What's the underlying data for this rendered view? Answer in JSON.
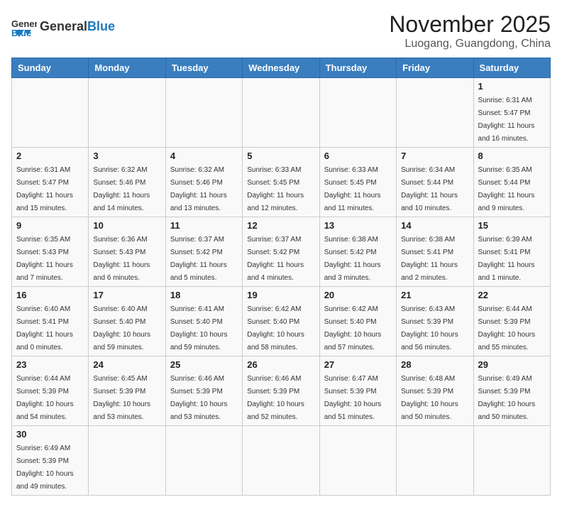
{
  "header": {
    "logo_general": "General",
    "logo_blue": "Blue",
    "month_title": "November 2025",
    "location": "Luogang, Guangdong, China"
  },
  "weekdays": [
    "Sunday",
    "Monday",
    "Tuesday",
    "Wednesday",
    "Thursday",
    "Friday",
    "Saturday"
  ],
  "days": {
    "d1": {
      "num": "1",
      "info": "Sunrise: 6:31 AM\nSunset: 5:47 PM\nDaylight: 11 hours\nand 16 minutes."
    },
    "d2": {
      "num": "2",
      "info": "Sunrise: 6:31 AM\nSunset: 5:47 PM\nDaylight: 11 hours\nand 15 minutes."
    },
    "d3": {
      "num": "3",
      "info": "Sunrise: 6:32 AM\nSunset: 5:46 PM\nDaylight: 11 hours\nand 14 minutes."
    },
    "d4": {
      "num": "4",
      "info": "Sunrise: 6:32 AM\nSunset: 5:46 PM\nDaylight: 11 hours\nand 13 minutes."
    },
    "d5": {
      "num": "5",
      "info": "Sunrise: 6:33 AM\nSunset: 5:45 PM\nDaylight: 11 hours\nand 12 minutes."
    },
    "d6": {
      "num": "6",
      "info": "Sunrise: 6:33 AM\nSunset: 5:45 PM\nDaylight: 11 hours\nand 11 minutes."
    },
    "d7": {
      "num": "7",
      "info": "Sunrise: 6:34 AM\nSunset: 5:44 PM\nDaylight: 11 hours\nand 10 minutes."
    },
    "d8": {
      "num": "8",
      "info": "Sunrise: 6:35 AM\nSunset: 5:44 PM\nDaylight: 11 hours\nand 9 minutes."
    },
    "d9": {
      "num": "9",
      "info": "Sunrise: 6:35 AM\nSunset: 5:43 PM\nDaylight: 11 hours\nand 7 minutes."
    },
    "d10": {
      "num": "10",
      "info": "Sunrise: 6:36 AM\nSunset: 5:43 PM\nDaylight: 11 hours\nand 6 minutes."
    },
    "d11": {
      "num": "11",
      "info": "Sunrise: 6:37 AM\nSunset: 5:42 PM\nDaylight: 11 hours\nand 5 minutes."
    },
    "d12": {
      "num": "12",
      "info": "Sunrise: 6:37 AM\nSunset: 5:42 PM\nDaylight: 11 hours\nand 4 minutes."
    },
    "d13": {
      "num": "13",
      "info": "Sunrise: 6:38 AM\nSunset: 5:42 PM\nDaylight: 11 hours\nand 3 minutes."
    },
    "d14": {
      "num": "14",
      "info": "Sunrise: 6:38 AM\nSunset: 5:41 PM\nDaylight: 11 hours\nand 2 minutes."
    },
    "d15": {
      "num": "15",
      "info": "Sunrise: 6:39 AM\nSunset: 5:41 PM\nDaylight: 11 hours\nand 1 minute."
    },
    "d16": {
      "num": "16",
      "info": "Sunrise: 6:40 AM\nSunset: 5:41 PM\nDaylight: 11 hours\nand 0 minutes."
    },
    "d17": {
      "num": "17",
      "info": "Sunrise: 6:40 AM\nSunset: 5:40 PM\nDaylight: 10 hours\nand 59 minutes."
    },
    "d18": {
      "num": "18",
      "info": "Sunrise: 6:41 AM\nSunset: 5:40 PM\nDaylight: 10 hours\nand 59 minutes."
    },
    "d19": {
      "num": "19",
      "info": "Sunrise: 6:42 AM\nSunset: 5:40 PM\nDaylight: 10 hours\nand 58 minutes."
    },
    "d20": {
      "num": "20",
      "info": "Sunrise: 6:42 AM\nSunset: 5:40 PM\nDaylight: 10 hours\nand 57 minutes."
    },
    "d21": {
      "num": "21",
      "info": "Sunrise: 6:43 AM\nSunset: 5:39 PM\nDaylight: 10 hours\nand 56 minutes."
    },
    "d22": {
      "num": "22",
      "info": "Sunrise: 6:44 AM\nSunset: 5:39 PM\nDaylight: 10 hours\nand 55 minutes."
    },
    "d23": {
      "num": "23",
      "info": "Sunrise: 6:44 AM\nSunset: 5:39 PM\nDaylight: 10 hours\nand 54 minutes."
    },
    "d24": {
      "num": "24",
      "info": "Sunrise: 6:45 AM\nSunset: 5:39 PM\nDaylight: 10 hours\nand 53 minutes."
    },
    "d25": {
      "num": "25",
      "info": "Sunrise: 6:46 AM\nSunset: 5:39 PM\nDaylight: 10 hours\nand 53 minutes."
    },
    "d26": {
      "num": "26",
      "info": "Sunrise: 6:46 AM\nSunset: 5:39 PM\nDaylight: 10 hours\nand 52 minutes."
    },
    "d27": {
      "num": "27",
      "info": "Sunrise: 6:47 AM\nSunset: 5:39 PM\nDaylight: 10 hours\nand 51 minutes."
    },
    "d28": {
      "num": "28",
      "info": "Sunrise: 6:48 AM\nSunset: 5:39 PM\nDaylight: 10 hours\nand 50 minutes."
    },
    "d29": {
      "num": "29",
      "info": "Sunrise: 6:49 AM\nSunset: 5:39 PM\nDaylight: 10 hours\nand 50 minutes."
    },
    "d30": {
      "num": "30",
      "info": "Sunrise: 6:49 AM\nSunset: 5:39 PM\nDaylight: 10 hours\nand 49 minutes."
    }
  }
}
